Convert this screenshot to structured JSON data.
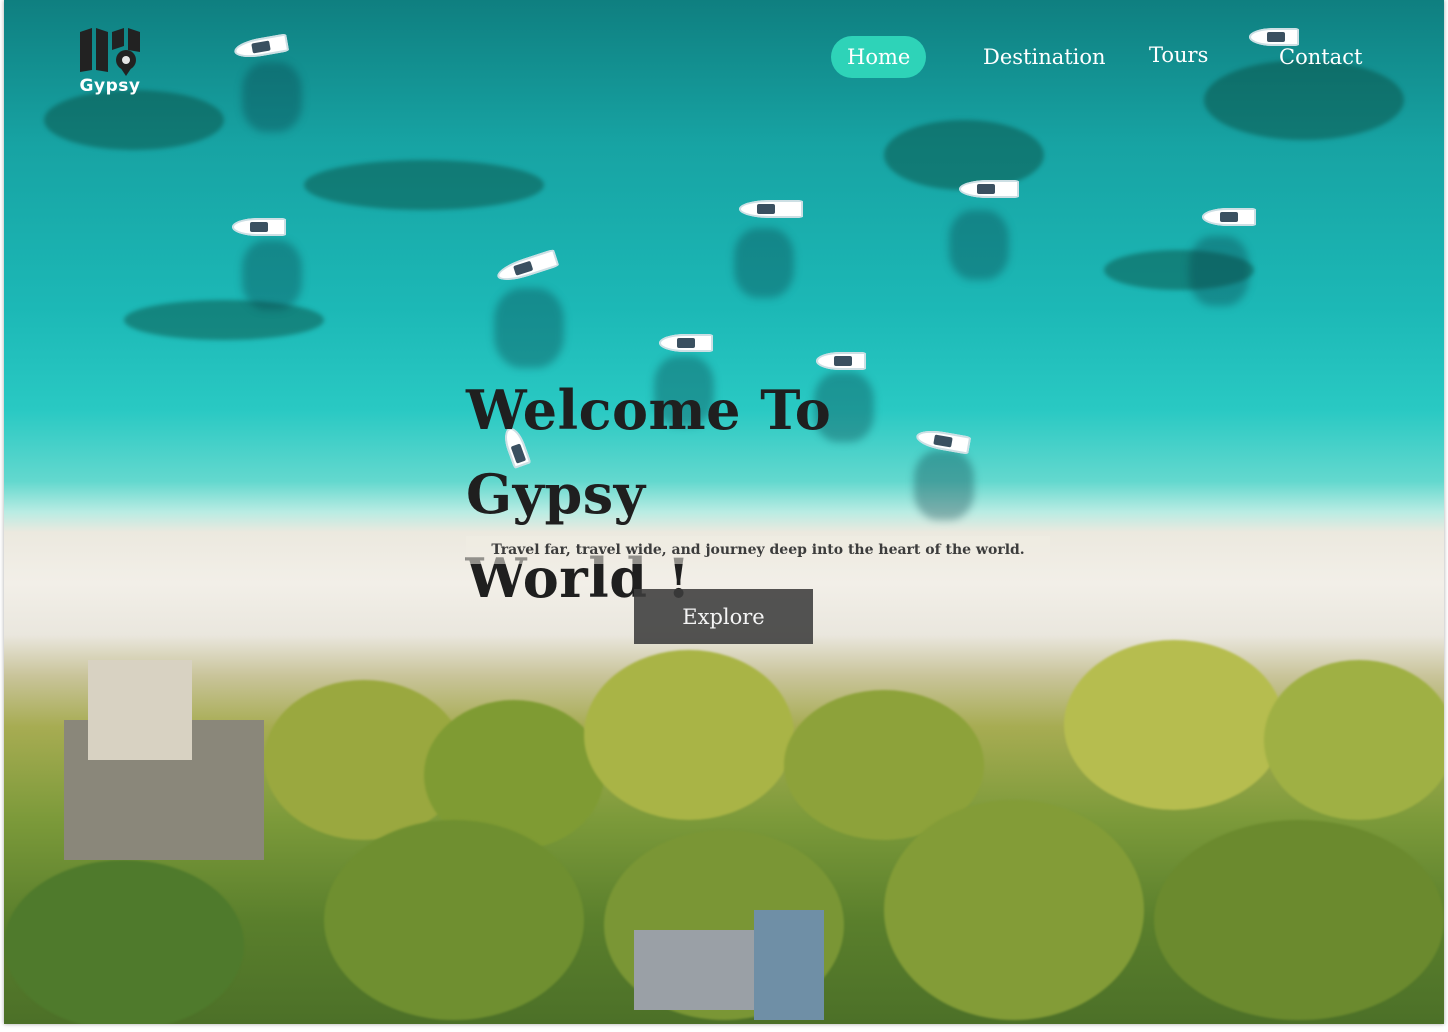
{
  "brand": {
    "name": "Gypsy",
    "logo_icon": "map-pin-logo-icon"
  },
  "nav": {
    "items": [
      {
        "label": "Home",
        "active": true
      },
      {
        "label": "Destination",
        "active": false
      },
      {
        "label": "Tours",
        "active": false
      },
      {
        "label": "Contact",
        "active": false
      }
    ],
    "active_color": "#2ed3b8"
  },
  "hero": {
    "title_line1": "Welcome To Gypsy",
    "title_line2": "World !",
    "subtitle": "Travel far, travel wide, and journey deep into the heart of the world.",
    "cta_label": "Explore"
  },
  "colors": {
    "title": "#1f1f1f",
    "button_bg": "#3c3c3c",
    "button_text": "#f4f4f4"
  }
}
